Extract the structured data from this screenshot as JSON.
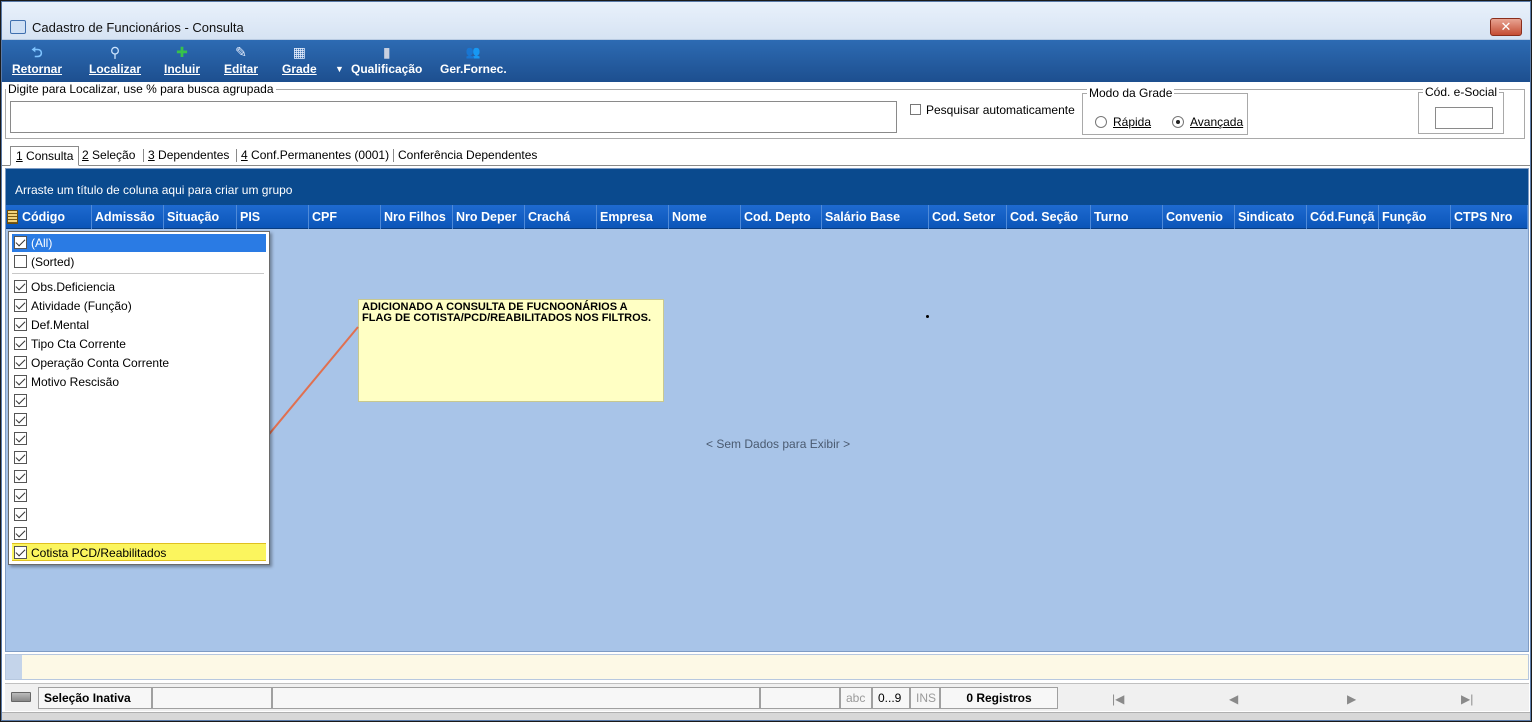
{
  "window": {
    "title": "Cadastro de Funcionários - Consulta",
    "close_label": "✕"
  },
  "toolbar": {
    "buttons": [
      {
        "label": "Retornar",
        "icon": "undo-arrow-icon",
        "glyph": "⮌",
        "color": "#7fc4ff"
      },
      {
        "label": "Localizar",
        "icon": "magnifier-icon",
        "glyph": "⚲",
        "color": "#cfe6ff"
      },
      {
        "label": "Incluir",
        "icon": "plus-circle-icon",
        "glyph": "✚",
        "color": "#37c24a"
      },
      {
        "label": "Editar",
        "icon": "edit-icon",
        "glyph": "✎",
        "color": "#e8f0ff"
      },
      {
        "label": "Grade",
        "icon": "grid-icon",
        "glyph": "▦",
        "color": "#e8f0ff"
      },
      {
        "label": "Qualificação",
        "icon": "qualification-icon",
        "glyph": "▮",
        "color": "#c8d0e0"
      },
      {
        "label": "Ger.Fornec.",
        "icon": "people-icon",
        "glyph": "👥",
        "color": "#f0c060"
      }
    ],
    "dropdown_glyph": "▼"
  },
  "search": {
    "legend": "Digite para Localizar, use % para busca agrupada",
    "value": "",
    "auto_search_label": "Pesquisar automaticamente",
    "auto_search_checked": false,
    "grid_mode": {
      "legend": "Modo da Grade",
      "options": [
        "Rápida",
        "Avançada"
      ],
      "selected": "Avançada"
    },
    "esocial": {
      "legend": "Cód. e-Social",
      "value": ""
    }
  },
  "tabs": [
    {
      "key": "1",
      "rest": " Consulta",
      "active": true
    },
    {
      "key": "2",
      "rest": " Seleção",
      "active": false
    },
    {
      "key": "3",
      "rest": " Dependentes",
      "active": false
    },
    {
      "key": "4",
      "rest": " Conf.Permanentes (0001)",
      "active": false
    },
    {
      "key": "",
      "rest": "Conferência Dependentes",
      "active": false
    }
  ],
  "grid": {
    "group_hint": "Arraste um título de coluna aqui para criar um grupo",
    "columns": [
      "Código",
      "Admissão",
      "Situação",
      "PIS",
      "CPF",
      "Nro Filhos",
      "Nro Deper",
      "Crachá",
      "Empresa",
      "Nome",
      "Cod. Depto",
      "Salário Base",
      "Cod. Setor",
      "Cod. Seção",
      "Turno",
      "Convenio",
      "Sindicato",
      "Cód.Funçã",
      "Função",
      "CTPS Nro"
    ],
    "empty_message": "< Sem Dados para Exibir >"
  },
  "filter_dropdown": {
    "items": [
      {
        "label": "(All)",
        "checked": true,
        "selected": true
      },
      {
        "label": "(Sorted)",
        "checked": false
      },
      {
        "label": "Obs.Deficiencia",
        "checked": true
      },
      {
        "label": "Atividade (Função)",
        "checked": true
      },
      {
        "label": "Def.Mental",
        "checked": true
      },
      {
        "label": "Tipo Cta Corrente",
        "checked": true
      },
      {
        "label": "Operação Conta Corrente",
        "checked": true
      },
      {
        "label": "Motivo Rescisão",
        "checked": true
      },
      {
        "label": "",
        "checked": true
      },
      {
        "label": "",
        "checked": true
      },
      {
        "label": "",
        "checked": true
      },
      {
        "label": "",
        "checked": true
      },
      {
        "label": "",
        "checked": true
      },
      {
        "label": "",
        "checked": true
      },
      {
        "label": "",
        "checked": true
      },
      {
        "label": "",
        "checked": true
      },
      {
        "label": "Cotista PCD/Reabilitados",
        "checked": true,
        "highlight": true
      }
    ]
  },
  "annotation": {
    "text": "ADICIONADO A CONSULTA DE FUCNOONÁRIOS A FLAG DE COTISTA/PCD/REABILITADOS NOS FILTROS.",
    "arrow_color": "#e07050"
  },
  "statusbar": {
    "selection": "Seleção Inativa",
    "abc": "abc",
    "range": "0...9",
    "ins": "INS",
    "records": "0 Registros",
    "nav_first": "|◀",
    "nav_prev": "◀",
    "nav_next": "▶",
    "nav_last": "▶|"
  }
}
